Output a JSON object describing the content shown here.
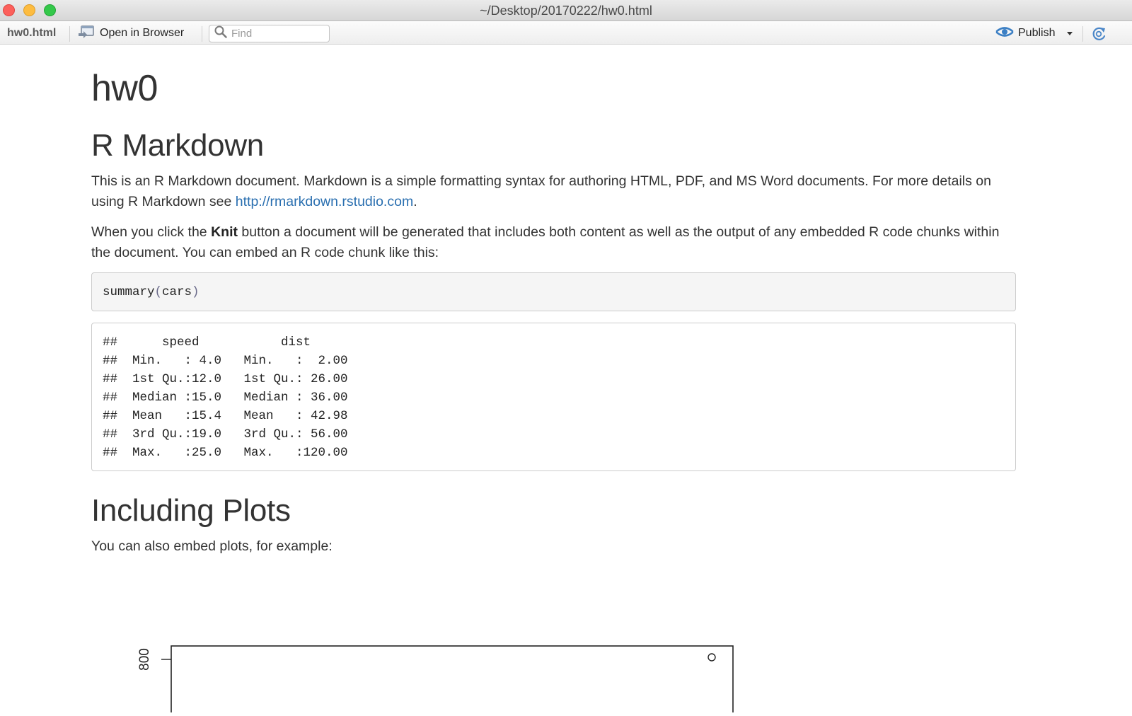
{
  "window": {
    "title": "~/Desktop/20170222/hw0.html"
  },
  "toolbar": {
    "filename": "hw0.html",
    "open_in_browser": "Open in Browser",
    "find_placeholder": "Find",
    "find_value": "",
    "publish": "Publish",
    "icons": {
      "open": "open-in-browser-icon",
      "find": "search-icon",
      "publish": "publish-icon",
      "publish_menu": "chevron-down-icon",
      "refresh": "refresh-icon"
    }
  },
  "doc": {
    "title": "hw0",
    "section1_heading": "R Markdown",
    "p1_text": "This is an R Markdown document. Markdown is a simple formatting syntax for authoring HTML, PDF, and MS Word documents. For more details on using R Markdown see ",
    "p1_link": "http://rmarkdown.rstudio.com",
    "p1_end": ".",
    "p2_start": "When you click the ",
    "p2_bold": "Knit",
    "p2_end": " button a document will be generated that includes both content as well as the output of any embedded R code chunks within the document. You can embed an R code chunk like this:",
    "code_fn": "summary",
    "code_open": "(",
    "code_arg": "cars",
    "code_close": ")",
    "output_lines": [
      "##      speed           dist       ",
      "##  Min.   : 4.0   Min.   :  2.00  ",
      "##  1st Qu.:12.0   1st Qu.: 26.00  ",
      "##  Median :15.0   Median : 36.00  ",
      "##  Mean   :15.4   Mean   : 42.98  ",
      "##  3rd Qu.:19.0   3rd Qu.: 56.00  ",
      "##  Max.   :25.0   Max.   :120.00  "
    ],
    "section2_heading": "Including Plots",
    "p3_text": "You can also embed plots, for example:"
  },
  "plot": {
    "y_tick_label": "800"
  },
  "colors": {
    "link": "#2a6fb0",
    "close": "#fc605b",
    "minimize": "#fdbc40",
    "maximize": "#34c84a",
    "publish_icon": "#3b7fc4"
  }
}
